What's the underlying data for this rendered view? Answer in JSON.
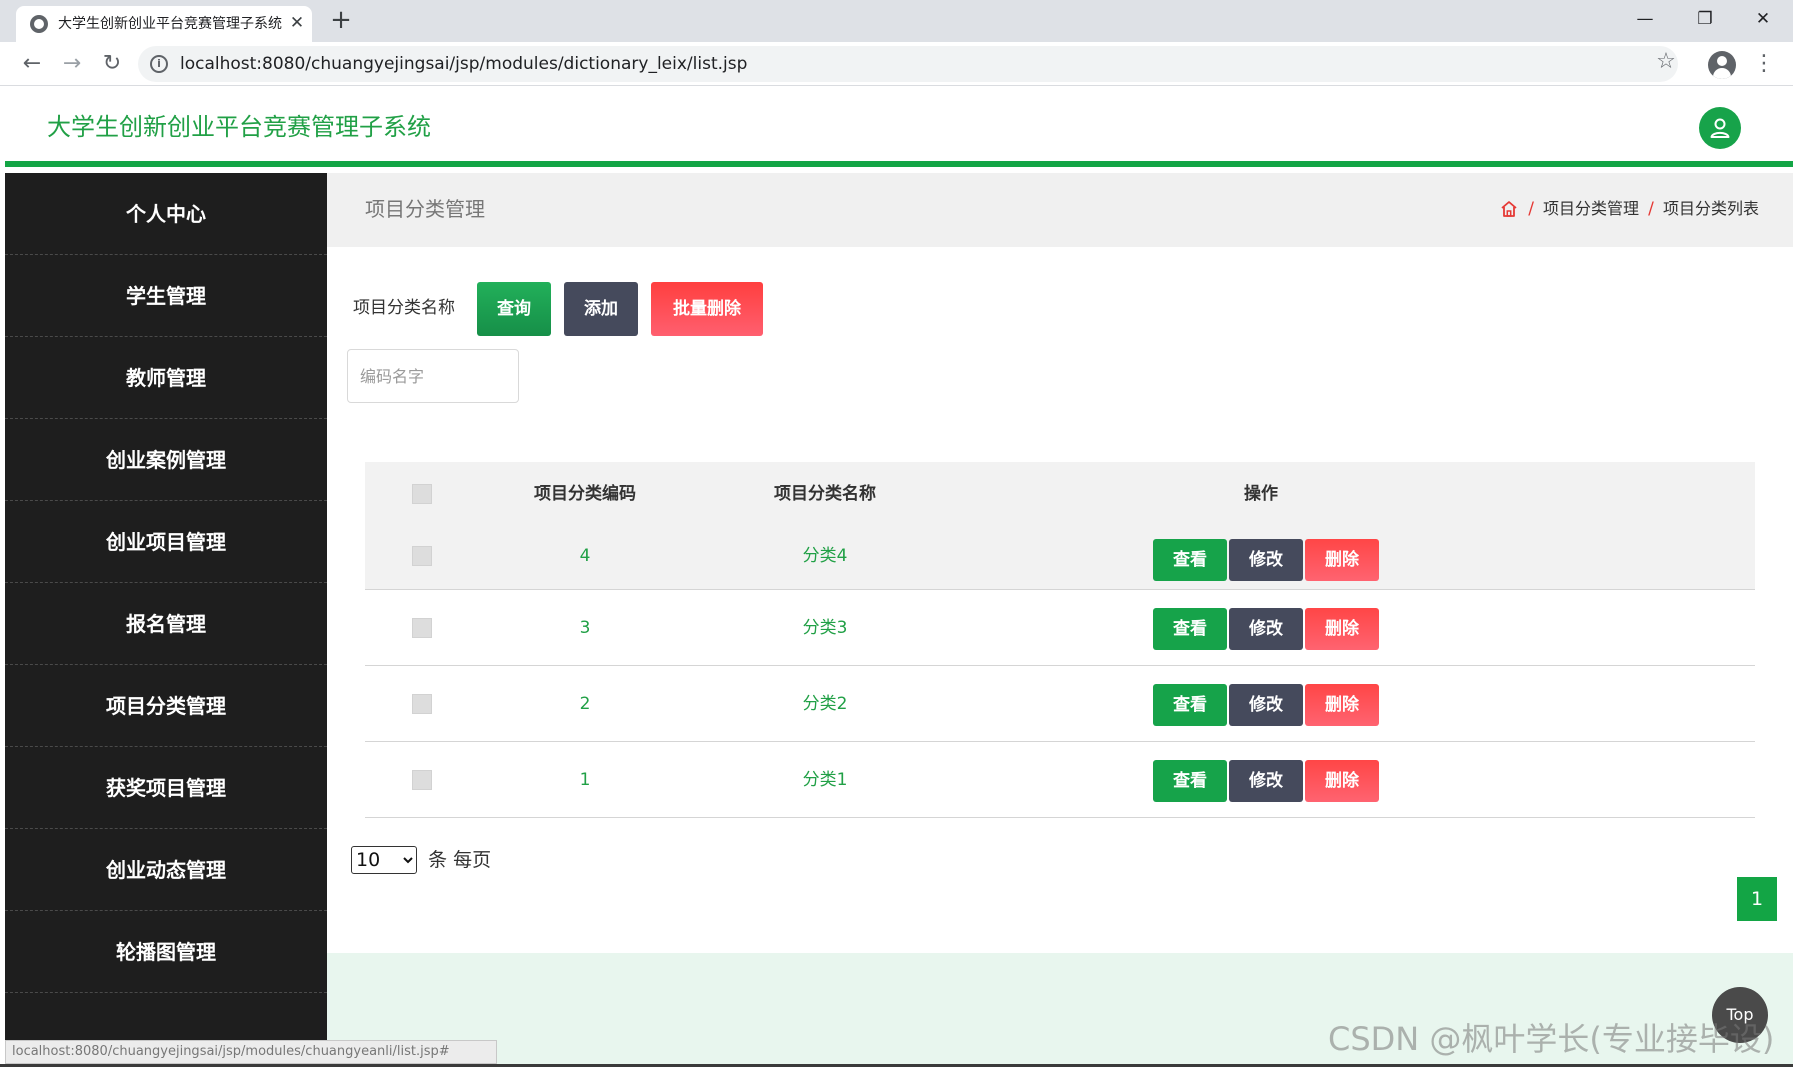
{
  "browser": {
    "tab_title": "大学生创新创业平台竞赛管理子系统",
    "url": "localhost:8080/chuangyejingsai/jsp/modules/dictionary_leix/list.jsp",
    "status_url": "localhost:8080/chuangyejingsai/jsp/modules/chuangyeanli/list.jsp#"
  },
  "header": {
    "title": "大学生创新创业平台竞赛管理子系统"
  },
  "sidebar": {
    "items": [
      {
        "label": "个人中心"
      },
      {
        "label": "学生管理"
      },
      {
        "label": "教师管理"
      },
      {
        "label": "创业案例管理"
      },
      {
        "label": "创业项目管理"
      },
      {
        "label": "报名管理"
      },
      {
        "label": "项目分类管理"
      },
      {
        "label": "获奖项目管理"
      },
      {
        "label": "创业动态管理"
      },
      {
        "label": "轮播图管理"
      }
    ]
  },
  "page": {
    "title": "项目分类管理",
    "breadcrumb": [
      "项目分类管理",
      "项目分类列表"
    ],
    "breadcrumb_separator": "/"
  },
  "search": {
    "label": "项目分类名称",
    "query_label": "查询",
    "add_label": "添加",
    "batch_delete_label": "批量删除",
    "placeholder": "编码名字"
  },
  "table": {
    "columns": [
      "项目分类编码",
      "项目分类名称",
      "操作"
    ],
    "actions": {
      "view": "查看",
      "edit": "修改",
      "delete": "删除"
    },
    "rows": [
      {
        "code": "4",
        "name": "分类4"
      },
      {
        "code": "3",
        "name": "分类3"
      },
      {
        "code": "2",
        "name": "分类2"
      },
      {
        "code": "1",
        "name": "分类1"
      }
    ]
  },
  "pagination": {
    "page_size": "10",
    "per_page_text": "条 每页",
    "current_page": "1"
  },
  "top_button": "Top",
  "watermark": "CSDN @枫叶学长(专业接毕设)",
  "colors": {
    "brand_green": "#13a545",
    "dark_button": "#454a5c",
    "danger_red": "#ff4646",
    "sidebar_bg": "#1e1e1e"
  }
}
